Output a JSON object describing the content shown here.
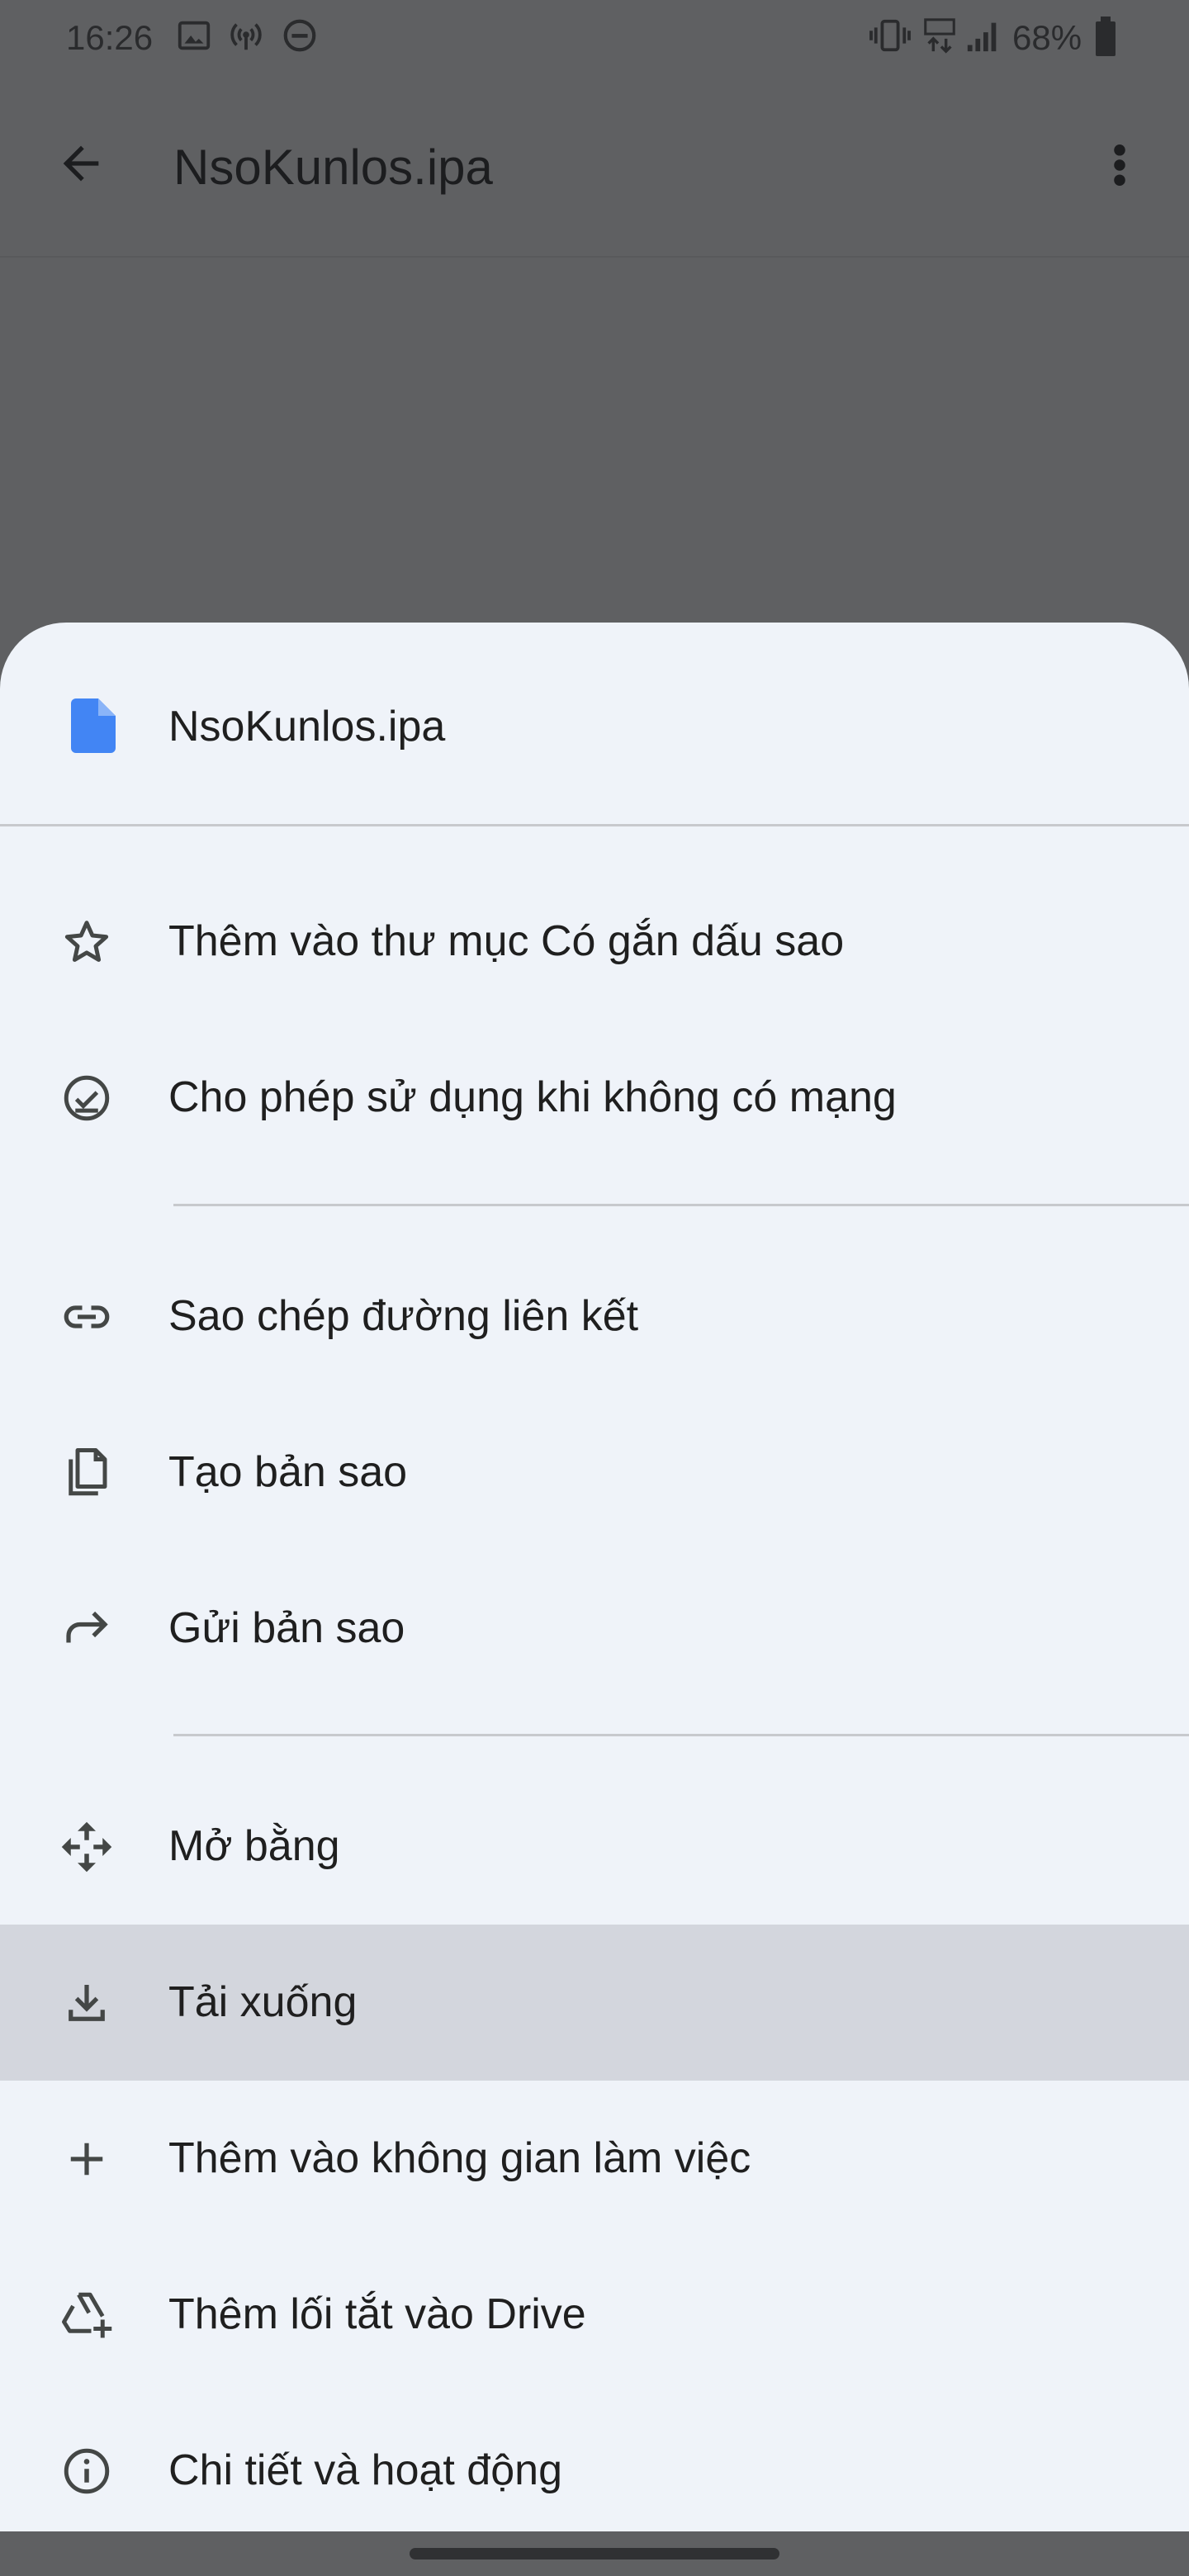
{
  "status_bar": {
    "time": "16:26",
    "battery": "68%",
    "left_icons": [
      "image-icon",
      "hotspot-icon",
      "do-not-disturb-icon"
    ],
    "right_icons": [
      "vibrate-icon",
      "lte-icon",
      "signal-icon",
      "battery-icon"
    ]
  },
  "app_bar": {
    "title": "NsoKunlos.ipa",
    "back_icon": "arrow-back-icon",
    "more_icon": "more-vert-icon"
  },
  "sheet": {
    "file_name": "NsoKunlos.ipa",
    "file_icon_color": "#4285f4",
    "highlight_color": "#d3d6dd",
    "items": [
      {
        "icon": "star-outline-icon",
        "label": "Thêm vào thư mục Có gắn dấu sao"
      },
      {
        "icon": "offline-check-icon",
        "label": "Cho phép sử dụng khi không có mạng"
      },
      {
        "icon": "link-icon",
        "label": "Sao chép đường liên kết"
      },
      {
        "icon": "copy-icon",
        "label": "Tạo bản sao"
      },
      {
        "icon": "forward-icon",
        "label": "Gửi bản sao"
      },
      {
        "icon": "open-with-icon",
        "label": "Mở bằng"
      },
      {
        "icon": "download-icon",
        "label": "Tải xuống",
        "highlighted": true
      },
      {
        "icon": "add-icon",
        "label": "Thêm vào không gian làm việc"
      },
      {
        "icon": "drive-shortcut-icon",
        "label": "Thêm lối tắt vào Drive"
      },
      {
        "icon": "info-icon",
        "label": "Chi tiết và hoạt động"
      }
    ]
  }
}
